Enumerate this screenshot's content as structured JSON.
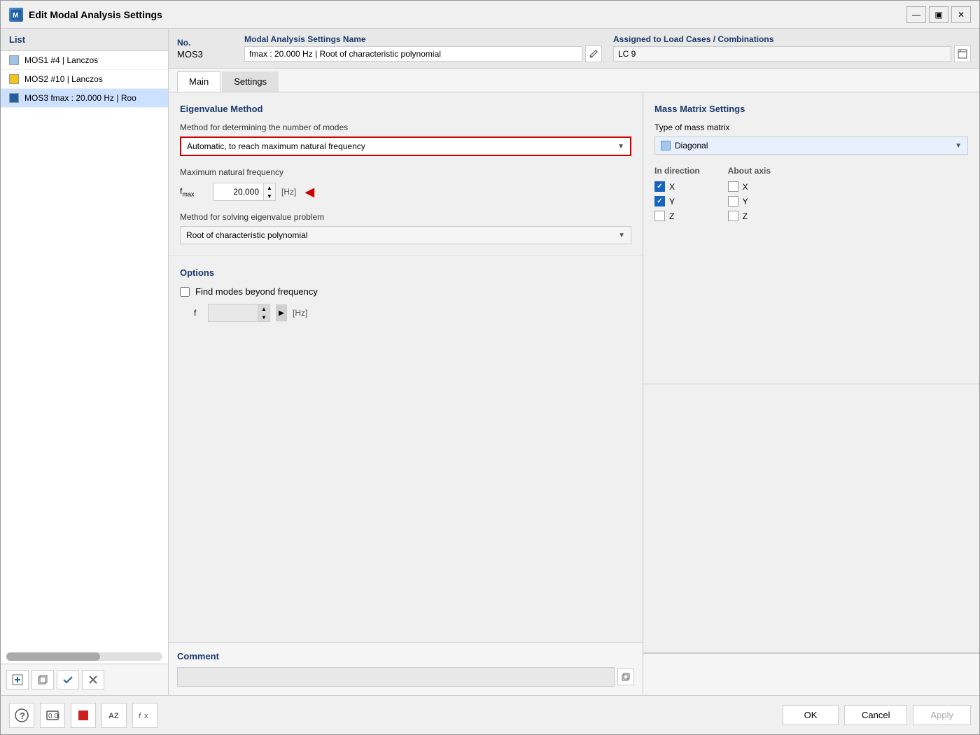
{
  "window": {
    "title": "Edit Modal Analysis Settings",
    "icon": "MA"
  },
  "sidebar": {
    "header": "List",
    "items": [
      {
        "id": "mos1",
        "color": "#a0c4e8",
        "label": "MOS1 #4 | Lanczos",
        "active": false
      },
      {
        "id": "mos2",
        "color": "#f5c518",
        "label": "MOS2 #10 | Lanczos",
        "active": false
      },
      {
        "id": "mos3",
        "color": "#2060a0",
        "label": "MOS3 fmax : 20.000 Hz | Roo",
        "active": true
      }
    ],
    "footer_buttons": [
      "new_icon",
      "duplicate_icon",
      "check_icon",
      "uncheck_icon"
    ]
  },
  "header": {
    "no_label": "No.",
    "no_value": "MOS3",
    "name_label": "Modal Analysis Settings Name",
    "name_value": "fmax : 20.000 Hz | Root of characteristic polynomial",
    "assigned_label": "Assigned to Load Cases / Combinations",
    "assigned_value": "LC 9"
  },
  "tabs": {
    "items": [
      {
        "id": "main",
        "label": "Main",
        "active": true
      },
      {
        "id": "settings",
        "label": "Settings",
        "active": false
      }
    ]
  },
  "eigenvalue": {
    "section_title": "Eigenvalue Method",
    "method_modes_label": "Method for determining the number of modes",
    "method_modes_value": "Automatic, to reach maximum natural frequency",
    "max_freq_label": "Maximum natural frequency",
    "fmax_label": "fmax",
    "fmax_value": "20.000",
    "fmax_unit": "[Hz]",
    "eigenvalue_problem_label": "Method for solving eigenvalue problem",
    "eigenvalue_problem_value": "Root of characteristic polynomial"
  },
  "options": {
    "section_title": "Options",
    "find_modes_label": "Find modes beyond frequency",
    "find_modes_checked": false,
    "f_label": "f",
    "f_value": "",
    "f_unit": "[Hz]"
  },
  "comment": {
    "section_title": "Comment",
    "placeholder": ""
  },
  "mass_matrix": {
    "section_title": "Mass Matrix Settings",
    "type_label": "Type of mass matrix",
    "type_value": "Diagonal",
    "in_direction_label": "In direction",
    "about_axis_label": "About axis",
    "directions": [
      {
        "label": "X",
        "checked_in": true,
        "checked_about": false
      },
      {
        "label": "Y",
        "checked_in": true,
        "checked_about": false
      },
      {
        "label": "Z",
        "checked_in": false,
        "checked_about": false
      }
    ]
  },
  "buttons": {
    "ok": "OK",
    "cancel": "Cancel",
    "apply": "Apply"
  },
  "bottom_icons": [
    "help_icon",
    "value_icon",
    "red_icon",
    "az_icon",
    "fx_icon"
  ]
}
